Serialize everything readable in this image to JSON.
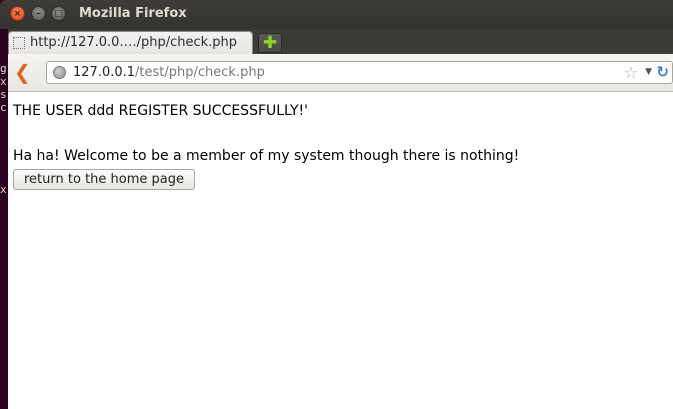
{
  "window": {
    "title": "Mozilla Firefox",
    "close_glyph": "×",
    "minimize_glyph": "–",
    "maximize_glyph": "□"
  },
  "desktop": {
    "terminal_fragments": [
      "g",
      "x",
      "s",
      "c",
      "x"
    ]
  },
  "tabs": [
    {
      "label": "http://127.0.0.…/php/check.php",
      "icon": "blank-page-icon",
      "active": true
    }
  ],
  "newtab": {
    "glyph": "✚",
    "icon": "plus-icon"
  },
  "navbar": {
    "back_glyph": "❮",
    "url_host": "127.0.0.1",
    "url_path": "/test/php/check.php",
    "star_glyph": "☆",
    "dropdown_glyph": "▼",
    "reload_glyph": "↻"
  },
  "page": {
    "message": "THE USER ddd REGISTER SUCCESSFULLY!'",
    "welcome": "Ha ha! Welcome to be a member of my system though there is nothing!",
    "home_button_label": "return to the home page"
  },
  "colors": {
    "titlebar": "#3c3b37",
    "close_button": "#e95420",
    "back_arrow": "#e1621f",
    "newtab_plus": "#8fd32e"
  }
}
